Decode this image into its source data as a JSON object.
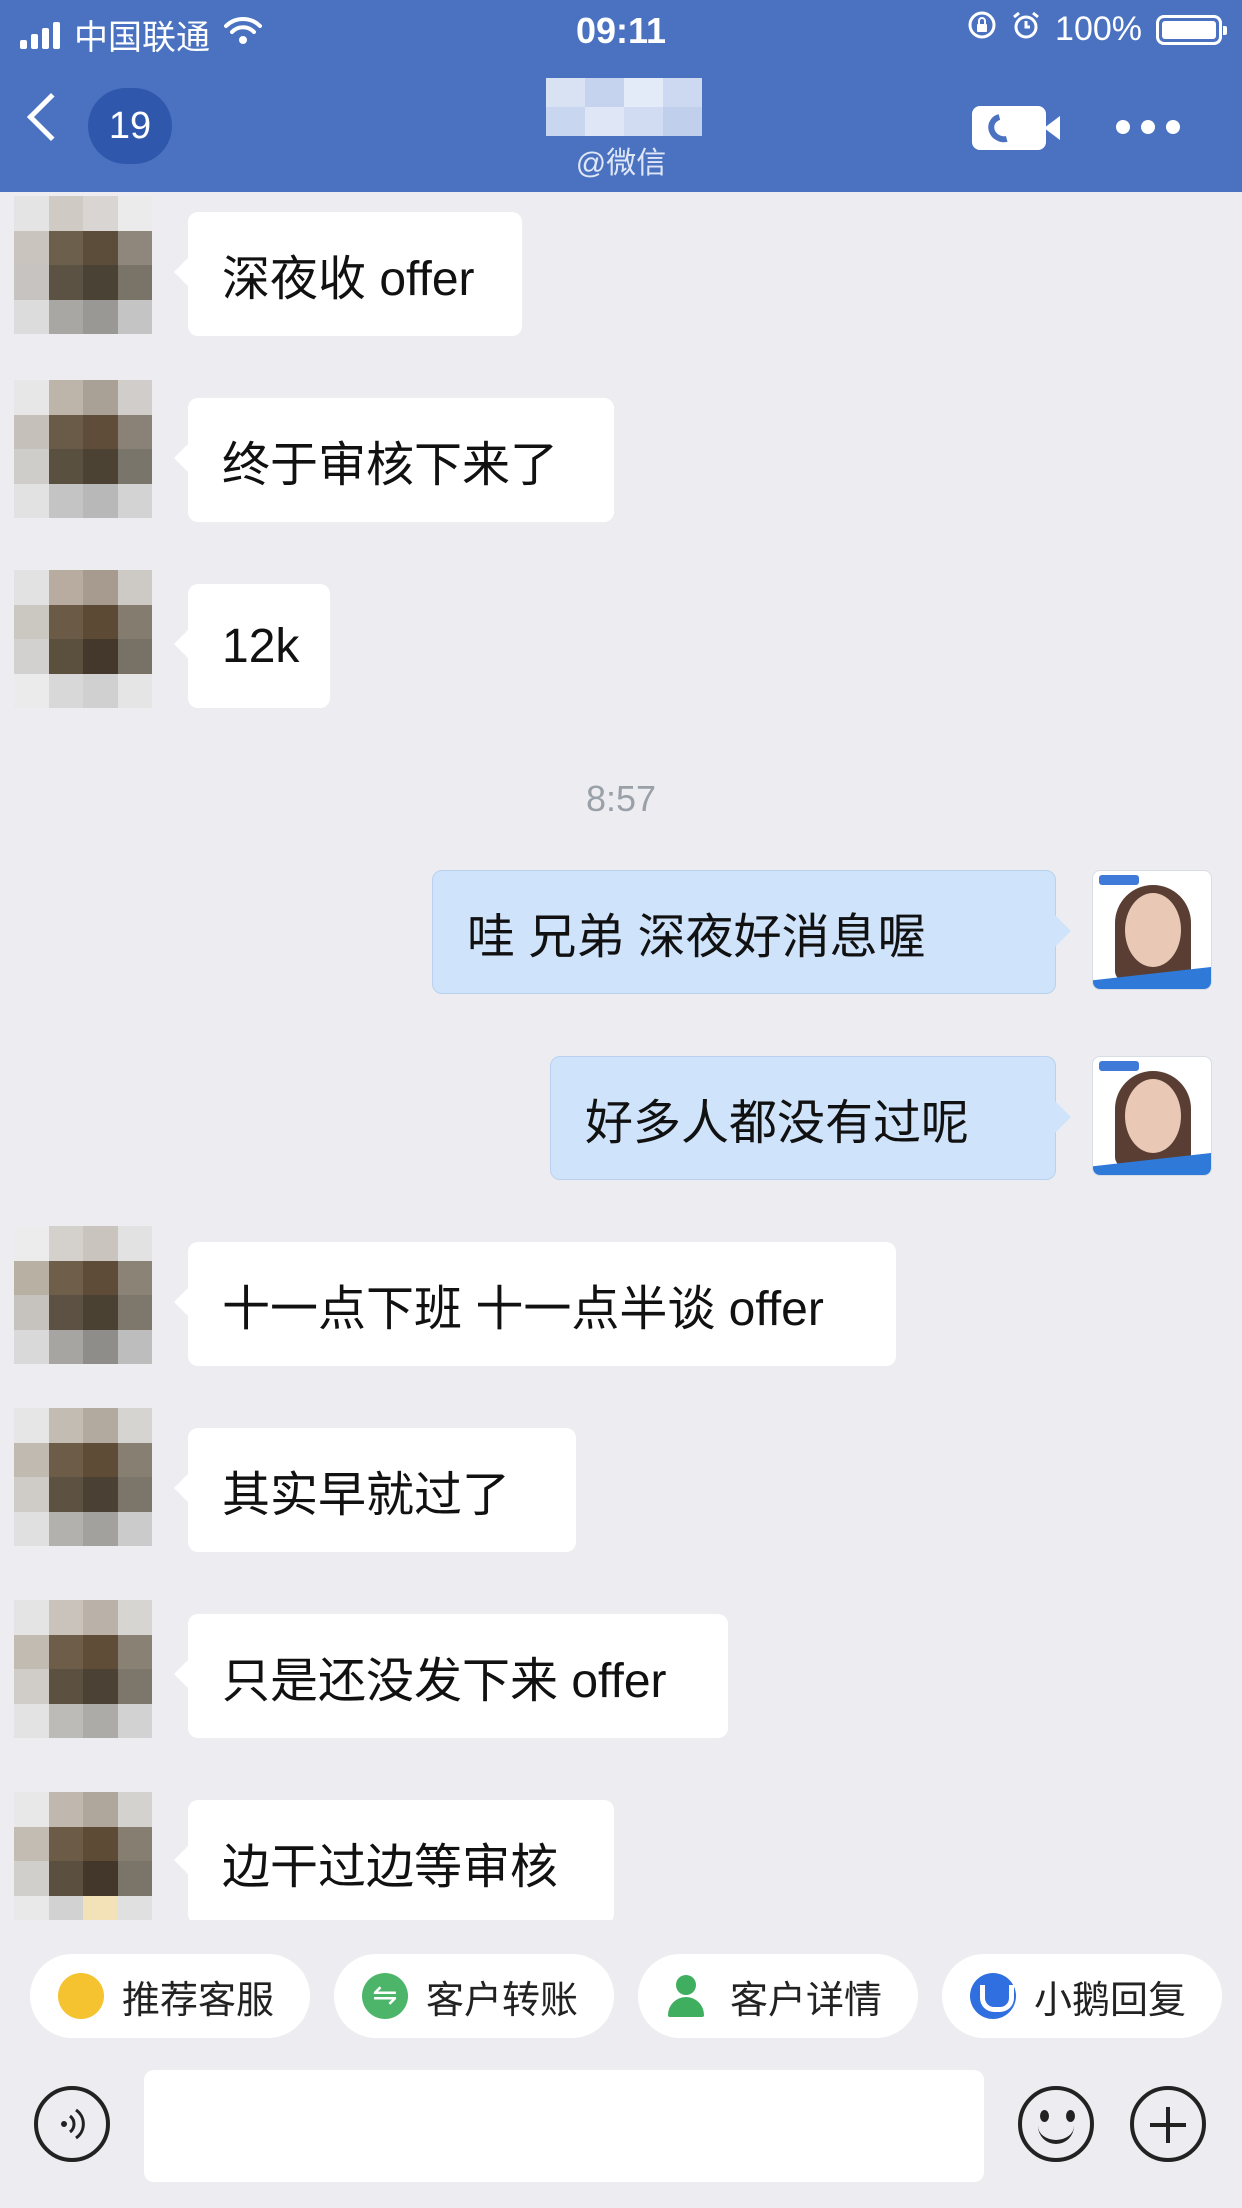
{
  "status_bar": {
    "carrier": "中国联通",
    "time": "09:11",
    "battery": "100%"
  },
  "header": {
    "unread_count": "19",
    "subtitle": "@微信"
  },
  "messages": [
    {
      "side": "in",
      "text": "深夜收 offer"
    },
    {
      "side": "in",
      "text": "终于审核下来了"
    },
    {
      "side": "in",
      "text": "12k"
    },
    {
      "side": "out",
      "text": "哇  兄弟  深夜好消息喔"
    },
    {
      "side": "out",
      "text": "好多人都没有过呢"
    },
    {
      "side": "in",
      "text": "十一点下班 十一点半谈 offer"
    },
    {
      "side": "in",
      "text": "其实早就过了"
    },
    {
      "side": "in",
      "text": "只是还没发下来 offer"
    },
    {
      "side": "in",
      "text": "边干过边等审核"
    }
  ],
  "time_separator": "8:57",
  "quick_actions": [
    {
      "label": "推荐客服",
      "icon": "recommend-icon"
    },
    {
      "label": "客户转账",
      "icon": "transfer-icon"
    },
    {
      "label": "客户详情",
      "icon": "customer-detail-icon"
    },
    {
      "label": "小鹅回复",
      "icon": "goose-reply-icon"
    }
  ],
  "input": {
    "value": "",
    "placeholder": ""
  },
  "icons": [
    "signal-icon",
    "wifi-icon",
    "rotation-lock-icon",
    "alarm-icon",
    "battery-icon",
    "back-icon",
    "video-call-icon",
    "more-icon",
    "voice-icon",
    "emoji-icon",
    "plus-icon"
  ],
  "colors": {
    "header": "#4a72c0",
    "badge": "#2f58ad",
    "background": "#ededf1",
    "incoming_bubble": "#ffffff",
    "outgoing_bubble": "#cfe3fb"
  }
}
